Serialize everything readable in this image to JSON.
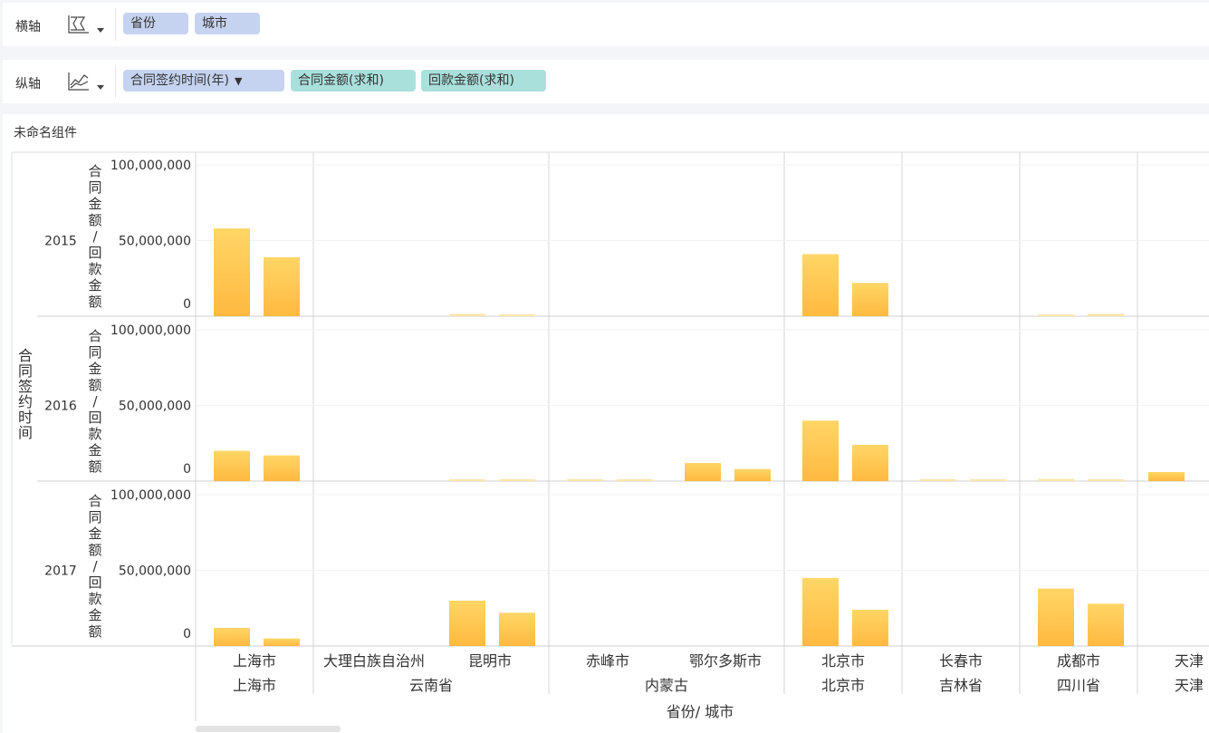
{
  "shelves": {
    "x": {
      "label": "横轴",
      "icon": "dimension-chart-icon",
      "fields": [
        "省份",
        "城市"
      ]
    },
    "y": {
      "label": "纵轴",
      "icon": "line-chart-icon",
      "fields": [
        "合同签约时间(年)",
        "合同金额(求和)",
        "回款金额(求和)"
      ],
      "filter_icon": "filter-icon"
    }
  },
  "widget": {
    "title": "未命名组件"
  },
  "chart_data": {
    "type": "bar",
    "ylabel_outer": "合同签约时间",
    "ylabel_inner": "合同金额/回款金额",
    "xlabel": "省份/ 城市",
    "ylim": [
      0,
      100000000
    ],
    "yticks": [
      "100,000,000",
      "50,000,000",
      "0"
    ],
    "rows": [
      "2015",
      "2016",
      "2017"
    ],
    "cities": [
      {
        "city": "上海市",
        "province": "上海市"
      },
      {
        "city": "大理白族自治州",
        "province": "云南省"
      },
      {
        "city": "昆明市",
        "province": "云南省"
      },
      {
        "city": "赤峰市",
        "province": "内蒙古"
      },
      {
        "city": "鄂尔多斯市",
        "province": "内蒙古"
      },
      {
        "city": "北京市",
        "province": "北京市"
      },
      {
        "city": "长春市",
        "province": "吉林省"
      },
      {
        "city": "成都市",
        "province": "四川省"
      },
      {
        "city": "天津",
        "province": "天津"
      }
    ],
    "provinces": [
      "上海市",
      "云南省",
      "内蒙古",
      "北京市",
      "吉林省",
      "四川省",
      "天津"
    ],
    "series": [
      {
        "values": [
          [
            58000000,
            0,
            1500000,
            0,
            0,
            41000000,
            0,
            1000000,
            0
          ],
          [
            20000000,
            0,
            1200000,
            400000,
            12000000,
            40000000,
            400000,
            1500000,
            6000000
          ],
          [
            12000000,
            0,
            30000000,
            0,
            0,
            45000000,
            0,
            38000000,
            0
          ]
        ]
      },
      {
        "values": [
          [
            39000000,
            0,
            1200000,
            0,
            0,
            22000000,
            0,
            1500000,
            0
          ],
          [
            17000000,
            0,
            1200000,
            400000,
            8000000,
            24000000,
            400000,
            1200000,
            0
          ],
          [
            5000000,
            0,
            22000000,
            0,
            0,
            24000000,
            0,
            28000000,
            0
          ]
        ]
      }
    ],
    "colors": {
      "bar_top": "#ffd666",
      "bar_bottom": "#ffb940",
      "faint": "#fde5a8"
    },
    "grid": true
  },
  "footer": {
    "scrollbar": "horizontal-scrollbar"
  }
}
